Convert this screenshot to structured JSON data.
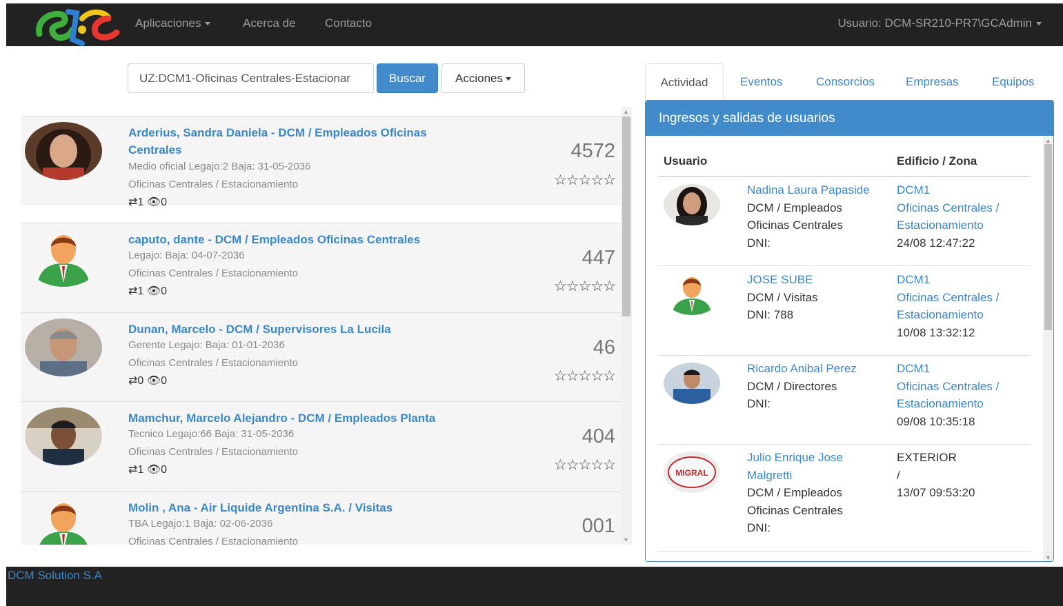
{
  "navbar": {
    "logo_alt": "GC",
    "menu_aplicaciones": "Aplicaciones",
    "menu_acerca": "Acerca de",
    "menu_contacto": "Contacto",
    "usuario": "Usuario: DCM-SR210-PR7\\GCAdmin"
  },
  "search": {
    "value": "UZ:DCM1-Oficinas Centrales-Estacionar",
    "buscar_label": "Buscar",
    "acciones_label": "Acciones"
  },
  "people": [
    {
      "name": "Arderius, Sandra Daniela - DCM / Empleados Oficinas Centrales",
      "info": "Medio oficial Legajo:2 Baja: 31-05-2036",
      "location": "Oficinas Centrales / Estacionamiento",
      "transfers": "1",
      "views": "0",
      "number": "4572",
      "stars": "☆☆☆☆☆",
      "avatar": "photo-woman"
    },
    {
      "name": "caputo, dante - DCM / Empleados Oficinas Centrales",
      "info": "Legajo: Baja: 04-07-2036",
      "location": "Oficinas Centrales / Estacionamiento",
      "transfers": "1",
      "views": "0",
      "number": "447",
      "stars": "☆☆☆☆☆",
      "avatar": "default-user"
    },
    {
      "name": "Dunan, Marcelo - DCM / Supervisores La Lucila",
      "info": "Gerente Legajo: Baja: 01-01-2036",
      "location": "Oficinas Centrales / Estacionamiento",
      "transfers": "0",
      "views": "0",
      "number": "46",
      "stars": "☆☆☆☆☆",
      "avatar": "photo-man-gray"
    },
    {
      "name": "Mamchur, Marcelo Alejandro - DCM / Empleados Planta",
      "info": "Tecnico Legajo:66 Baja: 31-05-2036",
      "location": "Oficinas Centrales / Estacionamiento",
      "transfers": "1",
      "views": "0",
      "number": "404",
      "stars": "☆☆☆☆☆",
      "avatar": "photo-man-dark"
    },
    {
      "name": "Molin  , Ana - Air Liquide Argentina S.A. / Visitas",
      "info": "TBA Legajo:1 Baja: 02-06-2036",
      "location": "Oficinas Centrales / Estacionamiento",
      "transfers": "",
      "views": "",
      "number": "001",
      "stars": "",
      "avatar": "default-user"
    }
  ],
  "tabs": {
    "actividad": "Actividad",
    "eventos": "Eventos",
    "consorcios": "Consorcios",
    "empresas": "Empresas",
    "equipos": "Equipos"
  },
  "panel": {
    "title": "Ingresos y salidas de usuarios",
    "col_usuario": "Usuario",
    "col_zona": "Edificio / Zona",
    "rows": [
      {
        "user_lines": [
          "Nadina Laura Papaside",
          "DCM / Empleados",
          "Oficinas Centrales",
          "DNI:"
        ],
        "zone_lines": [
          "DCM1",
          "Oficinas Centrales /",
          "Estacionamiento",
          "24/08 12:47:22"
        ],
        "avatar": "photo-woman"
      },
      {
        "user_lines": [
          "JOSE SUBE",
          "DCM / Visitas",
          "DNI:            788"
        ],
        "zone_lines": [
          "DCM1",
          "Oficinas Centrales /",
          "Estacionamiento",
          "10/08 13:32:12"
        ],
        "avatar": "default-user"
      },
      {
        "user_lines": [
          "Ricardo Anibal Perez",
          "DCM / Directores",
          "DNI:"
        ],
        "zone_lines": [
          "DCM1",
          "Oficinas Centrales /",
          "Estacionamiento",
          "09/08 10:35:18"
        ],
        "avatar": "photo-man-blue"
      },
      {
        "user_lines": [
          "Julio Enrique Jose",
          "Malgretti",
          "DCM / Empleados",
          "Oficinas Centrales",
          "DNI:"
        ],
        "zone_lines": [
          "EXTERIOR",
          "/",
          "13/07 09:53:20"
        ],
        "avatar": "photo-logo",
        "avatar_text": "MIGRAL"
      }
    ]
  },
  "footer": {
    "company": "DCM Solution S.A"
  },
  "colors": {
    "navbar": "#222222",
    "link": "#3a87c9",
    "primary": "#428bca"
  }
}
